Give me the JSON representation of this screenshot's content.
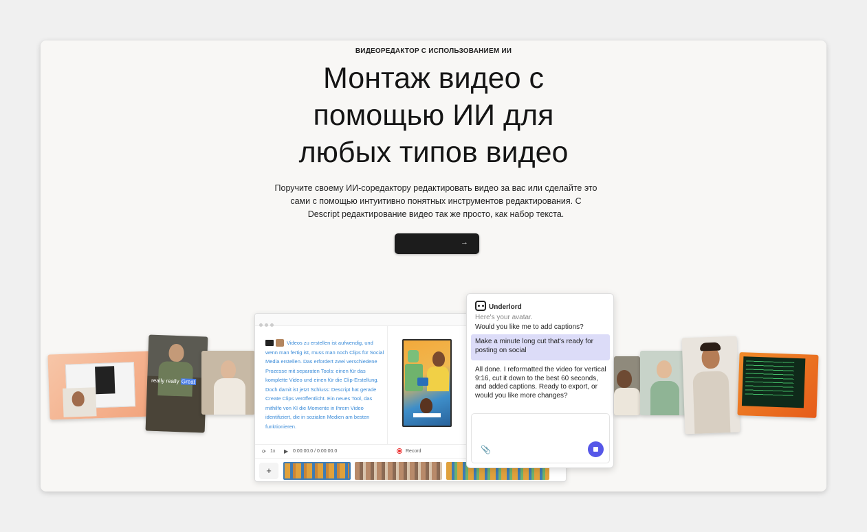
{
  "hero": {
    "eyebrow": "ВИДЕОРЕДАКТОР С ИСПОЛЬЗОВАНИЕМ ИИ",
    "headline_lines": [
      "Монтаж видео с",
      "помощью ИИ для",
      "любых типов видео"
    ],
    "subtitle": "Поручите своему ИИ-соредактору редактировать видео за вас или сделайте это сами с помощью интуитивно понятных инструментов редактирования. С Descript редактирование видео так же просто, как набор текста.",
    "cta_icon": "arrow-right-icon"
  },
  "editor": {
    "script_text": "Videos zu erstellen ist aufwendig, und wenn man fertig ist, muss man noch Clips für Social Media erstellen. Das erfordert zwei verschiedene Prozesse mit separaten Tools: einen für das komplette Video und einen für die Clip-Erstellung. Doch damit ist jetzt Schluss: Descript hat gerade Create Clips veröffentlicht. Ein neues Tool, das mithilfe von KI die Momente in Ihrem Video identifiziert, die in sozialen Medien am besten funktionieren.",
    "speed": "1x",
    "timecode": "0:00:00.0 / 0:00:00.0",
    "record_label": "Record",
    "add_label": "+",
    "caption_words": [
      "really",
      "really",
      "Great"
    ]
  },
  "chat": {
    "title": "Underlord",
    "msg_faded": "Here's your avatar.",
    "msg_question": "Would you like me to add captions?",
    "user_msg": "Make a minute long cut that's ready for posting on social",
    "reply": "All done. I reformatted the video for vertical 9:16, cut it down to the best 60 seconds, and added captions. Ready to export, or would you like more changes?",
    "attach_icon": "paperclip-icon",
    "stop_icon": "stop-icon"
  },
  "colors": {
    "accent": "#5657e8",
    "cta_bg": "#1c1c1c",
    "script_text": "#3a8bd8",
    "bubble": "#dcdcf8"
  }
}
